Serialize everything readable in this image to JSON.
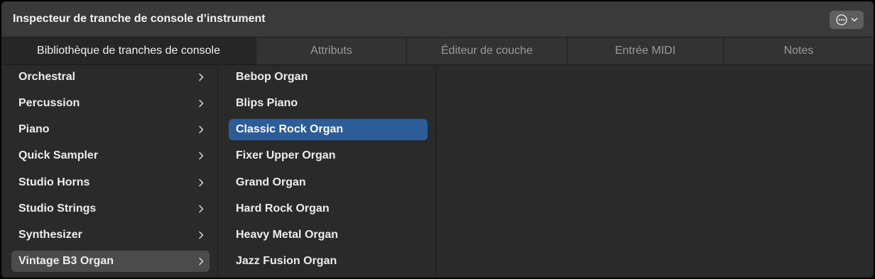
{
  "header": {
    "title": "Inspecteur de tranche de console d’instrument",
    "action_icon": "ellipsis-circle-icon",
    "action_chevron_icon": "chevron-down-icon"
  },
  "tabs": [
    {
      "label": "Bibliothèque de tranches de console",
      "active": true
    },
    {
      "label": "Attributs",
      "active": false
    },
    {
      "label": "Éditeur de couche",
      "active": false
    },
    {
      "label": "Entrée MIDI",
      "active": false
    },
    {
      "label": "Notes",
      "active": false
    }
  ],
  "categories": [
    {
      "label": "Orchestral"
    },
    {
      "label": "Percussion"
    },
    {
      "label": "Piano"
    },
    {
      "label": "Quick Sampler"
    },
    {
      "label": "Studio Horns"
    },
    {
      "label": "Studio Strings"
    },
    {
      "label": "Synthesizer"
    },
    {
      "label": "Vintage B3 Organ",
      "selected": true
    }
  ],
  "patches": [
    {
      "label": "Bebop Organ"
    },
    {
      "label": "Blips Piano"
    },
    {
      "label": "Classic Rock Organ",
      "selected": true
    },
    {
      "label": "Fixer Upper Organ"
    },
    {
      "label": "Grand Organ"
    },
    {
      "label": "Hard Rock Organ"
    },
    {
      "label": "Heavy Metal Organ"
    },
    {
      "label": "Jazz Fusion Organ"
    }
  ],
  "colors": {
    "selection_blue": "#2c5d99",
    "selection_gray": "#4b4b4b",
    "background": "#2a2a2a"
  }
}
